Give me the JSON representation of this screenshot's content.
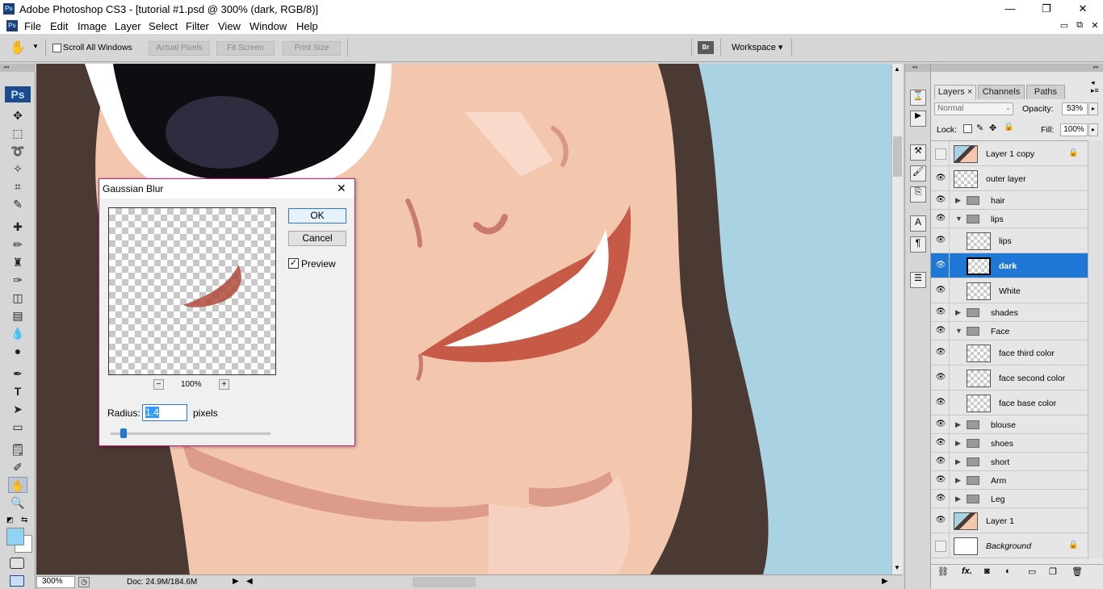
{
  "window": {
    "title": "Adobe Photoshop CS3 - [tutorial #1.psd @ 300% (dark, RGB/8)]",
    "app_icon": "Ps",
    "minimize": "—",
    "restore": "❐",
    "close": "✕"
  },
  "menu": {
    "items": [
      "File",
      "Edit",
      "Image",
      "Layer",
      "Select",
      "Filter",
      "View",
      "Window",
      "Help"
    ]
  },
  "options": {
    "scroll_all_windows": "Scroll All Windows",
    "actual_pixels": "Actual Pixels",
    "fit_screen": "Fit Screen",
    "print_size": "Print Size",
    "bridge_icon": "Br",
    "workspace": "Workspace ▾"
  },
  "toolbox": {
    "ps_logo": "Ps"
  },
  "status": {
    "zoom": "300%",
    "doc": "Doc: 24.9M/184.6M"
  },
  "layers_panel": {
    "tabs": [
      "Layers",
      "Channels",
      "Paths"
    ],
    "blend_mode": "Normal",
    "opacity_label": "Opacity:",
    "opacity_value": "53%",
    "lock_label": "Lock:",
    "fill_label": "Fill:",
    "fill_value": "100%",
    "layers": [
      {
        "name": "Layer 1 copy",
        "kind": "image",
        "visible": false,
        "locked": true
      },
      {
        "name": "outer layer",
        "kind": "layer",
        "visible": true
      },
      {
        "name": "hair",
        "kind": "group",
        "visible": true
      },
      {
        "name": "lips",
        "kind": "group-open",
        "visible": true
      },
      {
        "name": "lips",
        "kind": "child",
        "visible": true
      },
      {
        "name": "dark",
        "kind": "child",
        "visible": true,
        "selected": true
      },
      {
        "name": "White",
        "kind": "child",
        "visible": true
      },
      {
        "name": "shades",
        "kind": "group",
        "visible": true
      },
      {
        "name": "Face",
        "kind": "group-open",
        "visible": true
      },
      {
        "name": "face third color",
        "kind": "child",
        "visible": true
      },
      {
        "name": "face second color",
        "kind": "child",
        "visible": true
      },
      {
        "name": "face base color",
        "kind": "child",
        "visible": true
      },
      {
        "name": "blouse",
        "kind": "group",
        "visible": true
      },
      {
        "name": "shoes",
        "kind": "group",
        "visible": true
      },
      {
        "name": "short",
        "kind": "group",
        "visible": true
      },
      {
        "name": "Arm",
        "kind": "group",
        "visible": true
      },
      {
        "name": "Leg",
        "kind": "group",
        "visible": true
      },
      {
        "name": "Layer 1",
        "kind": "image",
        "visible": true
      },
      {
        "name": "Background",
        "kind": "background",
        "visible": false,
        "locked": true
      }
    ],
    "footer_icons": [
      "link-icon",
      "fx-icon",
      "mask-icon",
      "adjustment-icon",
      "new-group-icon",
      "new-layer-icon",
      "trash-icon"
    ]
  },
  "dialog": {
    "title": "Gaussian Blur",
    "ok": "OK",
    "cancel": "Cancel",
    "preview_label": "Preview",
    "preview_checked": true,
    "zoom_minus": "−",
    "zoom_value": "100%",
    "zoom_plus": "+",
    "radius_label": "Radius:",
    "radius_value": "1.4",
    "radius_unit": "pixels",
    "close": "✕"
  },
  "colors": {
    "accent_selection": "#1f77d6",
    "dialog_border": "#c02080",
    "foreground_color": "#8fd3f5",
    "background_color": "#ffffff"
  }
}
